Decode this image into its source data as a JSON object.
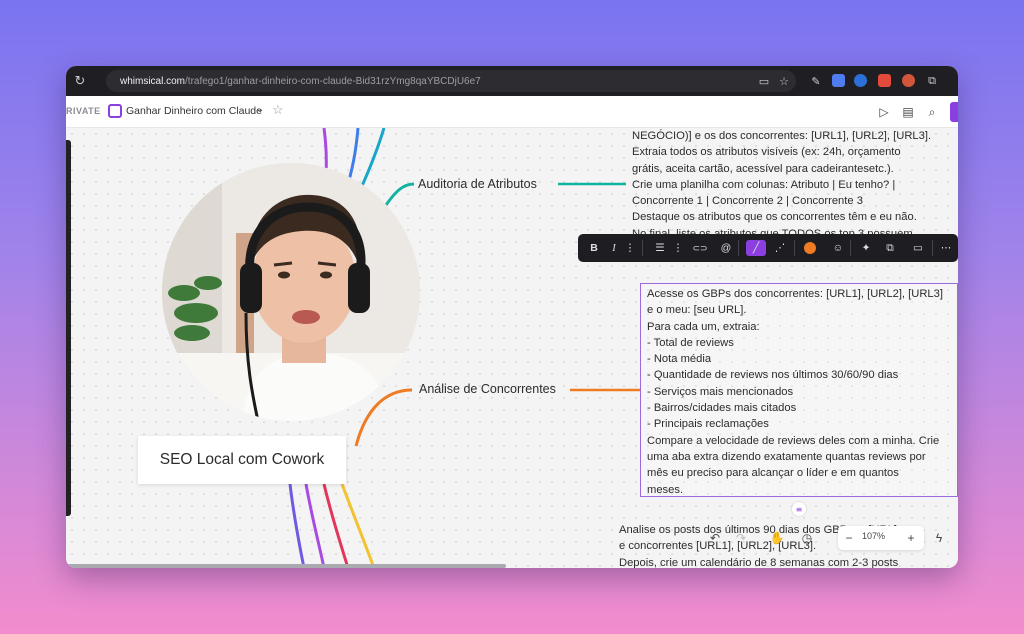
{
  "browser": {
    "url_host": "whimsical.com",
    "url_path": "/trafego1/ganhar-dinheiro-com-claude-Bid31rzYmg8qaYBCDjU6e7"
  },
  "app": {
    "workspace_label": "RIVATE",
    "doc_title": "Ganhar Dinheiro com Claude"
  },
  "mindmap": {
    "node_auditoria": "Auditoria de Atributos",
    "node_analise": "Análise de Concorrentes",
    "node_root": "SEO Local com Cowork",
    "auditoria_text": [
      "NEGÓCIO)] e os dos concorrentes: [URL1], [URL2], [URL3].",
      "Extraia todos os atributos visíveis (ex: 24h, orçamento",
      "grátis, aceita cartão, acessível para cadeirantesetc.).",
      "Crie uma planilha com colunas: Atributo | Eu tenho? |",
      "Concorrente 1 | Concorrente 2 | Concorrente 3",
      "Destaque os atributos que os concorrentes têm e eu não.",
      "No final, liste os atributos que TODOS os top 3 possuem."
    ],
    "analise_text": [
      "Acesse os GBPs dos concorrentes: [URL1], [URL2], [URL3]",
      "e o meu: [seu URL].",
      "Para cada um, extraia:",
      "- Total de reviews",
      "- Nota média",
      "- Quantidade de reviews nos últimos 30/60/90 dias",
      "- Serviços mais mencionados",
      "- Bairros/cidades mais citados",
      "- Principais reclamações",
      "Compare a velocidade de reviews deles com a minha. Crie",
      "uma aba extra dizendo exatamente quantas reviews por",
      "mês eu preciso para alcançar o líder e em quantos",
      "meses."
    ],
    "posts_text": [
      "Analise os posts dos últimos 90 dias dos GBPs ... [URL]",
      "e concorrentes [URL1], [URL2], [URL3].",
      "Depois, crie um calendário de 8 semanas com 2-3 posts"
    ]
  },
  "format_toolbar": {
    "bold": "B",
    "italic": "I",
    "more": "⋮",
    "list": "☰",
    "link": "🔗",
    "mention": "@",
    "comment": "💬",
    "ellipsis": "⋯"
  },
  "zoom": {
    "value": "107%",
    "minus": "−",
    "plus": "+"
  },
  "colors": {
    "accent": "#8b3fe0",
    "auditoria_branch": "#12b3a0",
    "analise_branch": "#ef7b22"
  }
}
